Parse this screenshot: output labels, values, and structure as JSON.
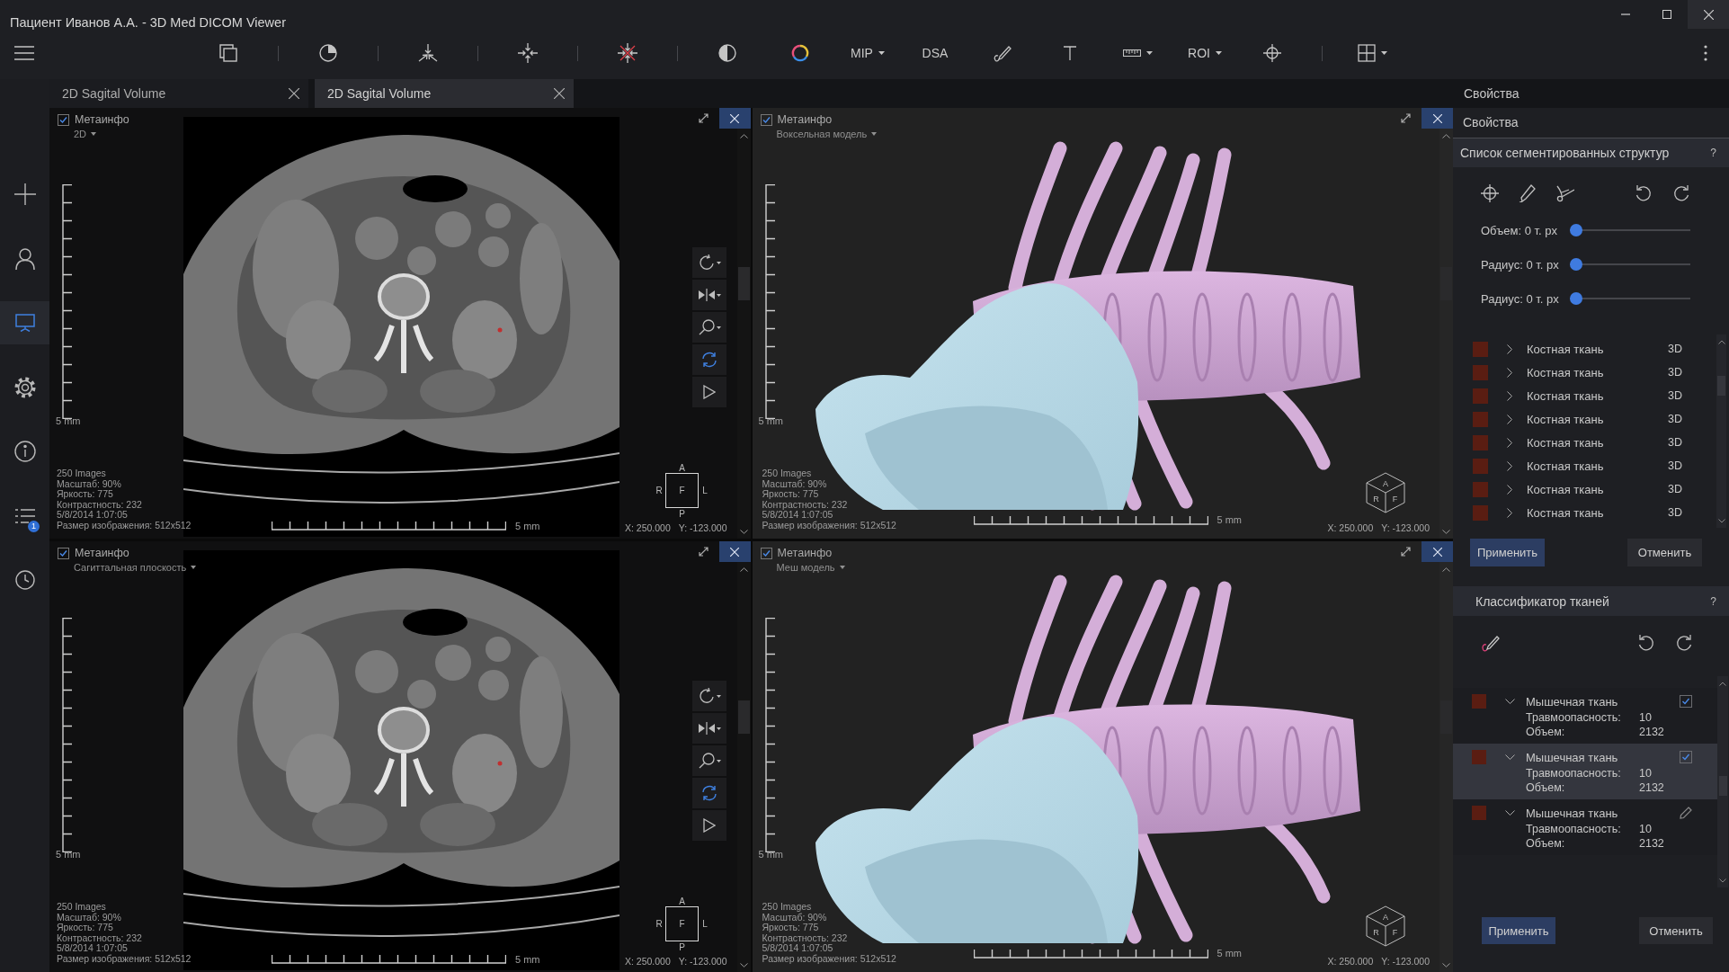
{
  "window": {
    "title": "Пациент Иванов А.А. - 3D Med DICOM Viewer"
  },
  "toolbar": {
    "text_buttons": [
      {
        "label": "MIP",
        "menu": true
      },
      {
        "label": "DSA",
        "menu": false
      },
      {
        "label": "ROI",
        "menu": true
      }
    ]
  },
  "sidebar": {
    "items": [
      {
        "kind": "add",
        "selected": false
      },
      {
        "kind": "patient",
        "selected": false
      },
      {
        "kind": "viewer",
        "selected": true
      },
      {
        "kind": "settings",
        "selected": false
      },
      {
        "kind": "info",
        "selected": false
      },
      {
        "kind": "tasks",
        "selected": false,
        "badge": "1"
      },
      {
        "kind": "history",
        "selected": false
      }
    ]
  },
  "tabs": [
    {
      "label": "2D Sagital Volume",
      "selected": false
    },
    {
      "label": "2D Sagital Volume",
      "selected": true
    }
  ],
  "viewports": [
    {
      "kind": "slice",
      "metainfo": {
        "label": "Метаинфо",
        "checked": true
      },
      "mode": "2D",
      "vertical_scale": "5 mm",
      "horizontal_scale": "5 mm",
      "info": [
        "250 Images",
        "Масштаб: 90%",
        "Яркость: 775",
        "Контрастность: 232",
        "5/8/2014 1:07:05",
        "Размер изображения: 512x512"
      ],
      "orientation": {
        "top": "A",
        "left": "R",
        "center": "F",
        "right": "L",
        "bottom": "P"
      },
      "coords": [
        "X: 250.000",
        "Y: -123.000"
      ]
    },
    {
      "kind": "model",
      "metainfo": {
        "label": "Метаинфо",
        "checked": true
      },
      "mode": "Воксельная модель",
      "vertical_scale": "5 mm",
      "horizontal_scale": "5 mm",
      "info": [
        "250 Images",
        "Масштаб: 90%",
        "Яркость: 775",
        "Контрастность: 232",
        "5/8/2014 1:07:05",
        "Размер изображения: 512x512"
      ],
      "orientation": {
        "top": "A",
        "left": "R",
        "right": "F"
      },
      "coords": [
        "X: 250.000",
        "Y: -123.000"
      ]
    },
    {
      "kind": "slice",
      "metainfo": {
        "label": "Метаинфо",
        "checked": true
      },
      "mode": "Сагиттальная плоскость",
      "vertical_scale": "5 mm",
      "horizontal_scale": "5 mm",
      "info": [
        "250 Images",
        "Масштаб: 90%",
        "Яркость: 775",
        "Контрастность: 232",
        "5/8/2014 1:07:05",
        "Размер изображения: 512x512"
      ],
      "orientation": {
        "top": "A",
        "left": "R",
        "center": "F",
        "right": "L",
        "bottom": "P"
      },
      "coords": [
        "X: 250.000",
        "Y: -123.000"
      ]
    },
    {
      "kind": "model",
      "metainfo": {
        "label": "Метаинфо",
        "checked": true
      },
      "mode": "Меш модель",
      "vertical_scale": "5 mm",
      "horizontal_scale": "5 mm",
      "info": [
        "250 Images",
        "Масштаб: 90%",
        "Яркость: 775",
        "Контрастность: 232",
        "5/8/2014 1:07:05",
        "Размер изображения: 512x512"
      ],
      "orientation": {
        "top": "A",
        "left": "R",
        "right": "F"
      },
      "coords": [
        "X: 250.000",
        "Y: -123.000"
      ]
    }
  ],
  "properties": {
    "header": "Свойства",
    "title": "Свойства",
    "segmentation": {
      "title": "Список сегментированных структур",
      "help": "?",
      "sliders": [
        {
          "label": "Объем: 0 т. px",
          "level": 0
        },
        {
          "label": "Радиус: 0 т. px",
          "level": 0
        },
        {
          "label": "Радиус: 0 т. px",
          "level": 0
        }
      ],
      "items": [
        {
          "name": "Костная ткань",
          "color": "#5a1d12",
          "expanded": false,
          "view": "3D"
        },
        {
          "name": "Костная ткань",
          "color": "#5a1d12",
          "expanded": false,
          "view": "3D"
        },
        {
          "name": "Костная ткань",
          "color": "#5a1d12",
          "expanded": false,
          "view": "3D"
        },
        {
          "name": "Костная ткань",
          "color": "#5a1d12",
          "expanded": false,
          "view": "3D"
        },
        {
          "name": "Костная ткань",
          "color": "#5a1d12",
          "expanded": false,
          "view": "3D"
        },
        {
          "name": "Костная ткань",
          "color": "#5a1d12",
          "expanded": false,
          "view": "3D"
        },
        {
          "name": "Костная ткань",
          "color": "#5a1d12",
          "expanded": false,
          "view": "3D"
        },
        {
          "name": "Костная ткань",
          "color": "#5a1d12",
          "expanded": false,
          "view": "3D"
        }
      ],
      "apply": "Применить",
      "cancel": "Отменить"
    },
    "tissues": {
      "title": "Классификатор тканей",
      "help": "?",
      "items": [
        {
          "name": "Мышечная ткань",
          "color": "#5a1d12",
          "expanded": true,
          "selected": false,
          "kind": "checkbox",
          "checked": true,
          "details": [
            {
              "label": "Травмоопасность:",
              "value": "10"
            },
            {
              "label": "Объем:",
              "value": "2132"
            }
          ]
        },
        {
          "name": "Мышечная ткань",
          "color": "#5a1d12",
          "expanded": true,
          "selected": true,
          "kind": "checkbox",
          "checked": true,
          "details": [
            {
              "label": "Травмоопасность:",
              "value": "10"
            },
            {
              "label": "Объем:",
              "value": "2132"
            }
          ]
        },
        {
          "name": "Мышечная ткань",
          "color": "#5a1d12",
          "expanded": true,
          "selected": false,
          "kind": "edit",
          "details": [
            {
              "label": "Травмоопасность:",
              "value": "10"
            },
            {
              "label": "Объем:",
              "value": "2132"
            }
          ]
        }
      ],
      "apply": "Применить",
      "cancel": "Отменить"
    }
  }
}
